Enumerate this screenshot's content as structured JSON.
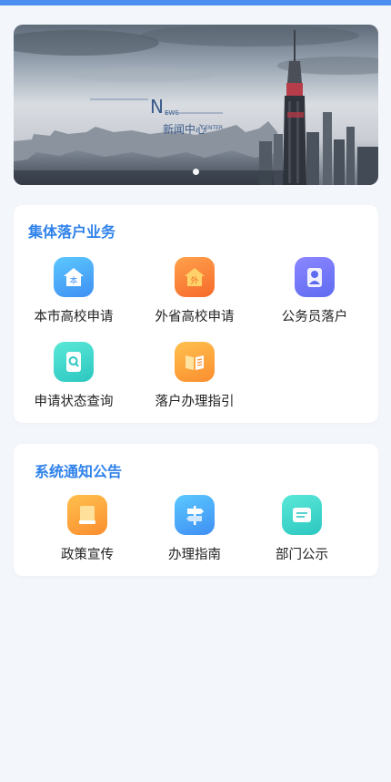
{
  "banner": {
    "logo_big": "N",
    "logo_small": "EWS",
    "title_cn": "新闻中心",
    "title_en": "CENTER"
  },
  "section1": {
    "title": "集体落户业务",
    "items": [
      {
        "label": "本市高校申请",
        "icon_char": "本",
        "icon": "house-icon"
      },
      {
        "label": "外省高校申请",
        "icon_char": "外",
        "icon": "house-icon"
      },
      {
        "label": "公务员落户",
        "icon": "person-icon"
      },
      {
        "label": "申请状态查询",
        "icon": "document-search-icon"
      },
      {
        "label": "落户办理指引",
        "icon": "book-icon"
      }
    ]
  },
  "section2": {
    "title": "系统通知公告",
    "items": [
      {
        "label": "政策宣传",
        "icon": "booklet-icon"
      },
      {
        "label": "办理指南",
        "icon": "signpost-icon"
      },
      {
        "label": "部门公示",
        "icon": "message-icon"
      }
    ]
  },
  "colors": {
    "accent": "#2f82ea",
    "topbar": "#4a8ff0",
    "background": "#f3f6fb"
  }
}
